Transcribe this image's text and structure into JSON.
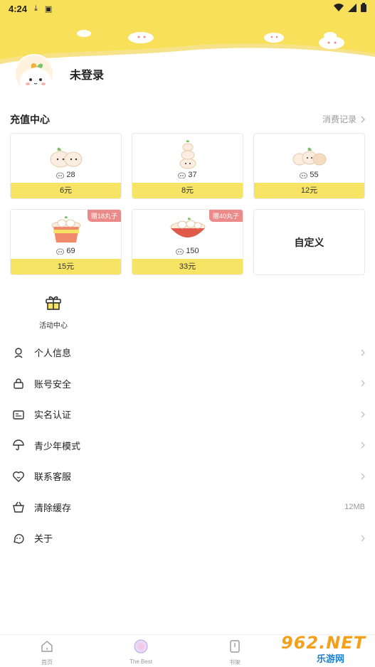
{
  "status_bar": {
    "time": "4:24"
  },
  "profile": {
    "name": "未登录"
  },
  "recharge": {
    "title": "充值中心",
    "history_link": "消费记录",
    "packages": [
      {
        "qty": "28",
        "price": "6元",
        "badge": ""
      },
      {
        "qty": "37",
        "price": "8元",
        "badge": ""
      },
      {
        "qty": "55",
        "price": "12元",
        "badge": ""
      },
      {
        "qty": "69",
        "price": "15元",
        "badge": "赠18丸子"
      },
      {
        "qty": "150",
        "price": "33元",
        "badge": "赠40丸子"
      }
    ],
    "custom_label": "自定义"
  },
  "activity": {
    "label": "活动中心"
  },
  "menu": [
    {
      "label": "个人信息",
      "icon": "person-icon",
      "right": ""
    },
    {
      "label": "账号安全",
      "icon": "lock-icon",
      "right": ""
    },
    {
      "label": "实名认证",
      "icon": "id-card-icon",
      "right": ""
    },
    {
      "label": "青少年模式",
      "icon": "umbrella-icon",
      "right": ""
    },
    {
      "label": "联系客服",
      "icon": "support-icon",
      "right": ""
    },
    {
      "label": "清除缓存",
      "icon": "basket-icon",
      "right": "12MB"
    },
    {
      "label": "关于",
      "icon": "chat-icon",
      "right": ""
    }
  ],
  "bottom_nav": [
    {
      "label": "首页",
      "icon": "home-icon"
    },
    {
      "label": "The Best",
      "icon": "the-best-icon"
    },
    {
      "label": "书架",
      "icon": "bookshelf-icon"
    }
  ],
  "watermark": {
    "text": "962.NET",
    "sub": "乐游网"
  },
  "colors": {
    "accent": "#f7e364",
    "badge": "#ec8a8a",
    "header": "#f8e05a"
  }
}
